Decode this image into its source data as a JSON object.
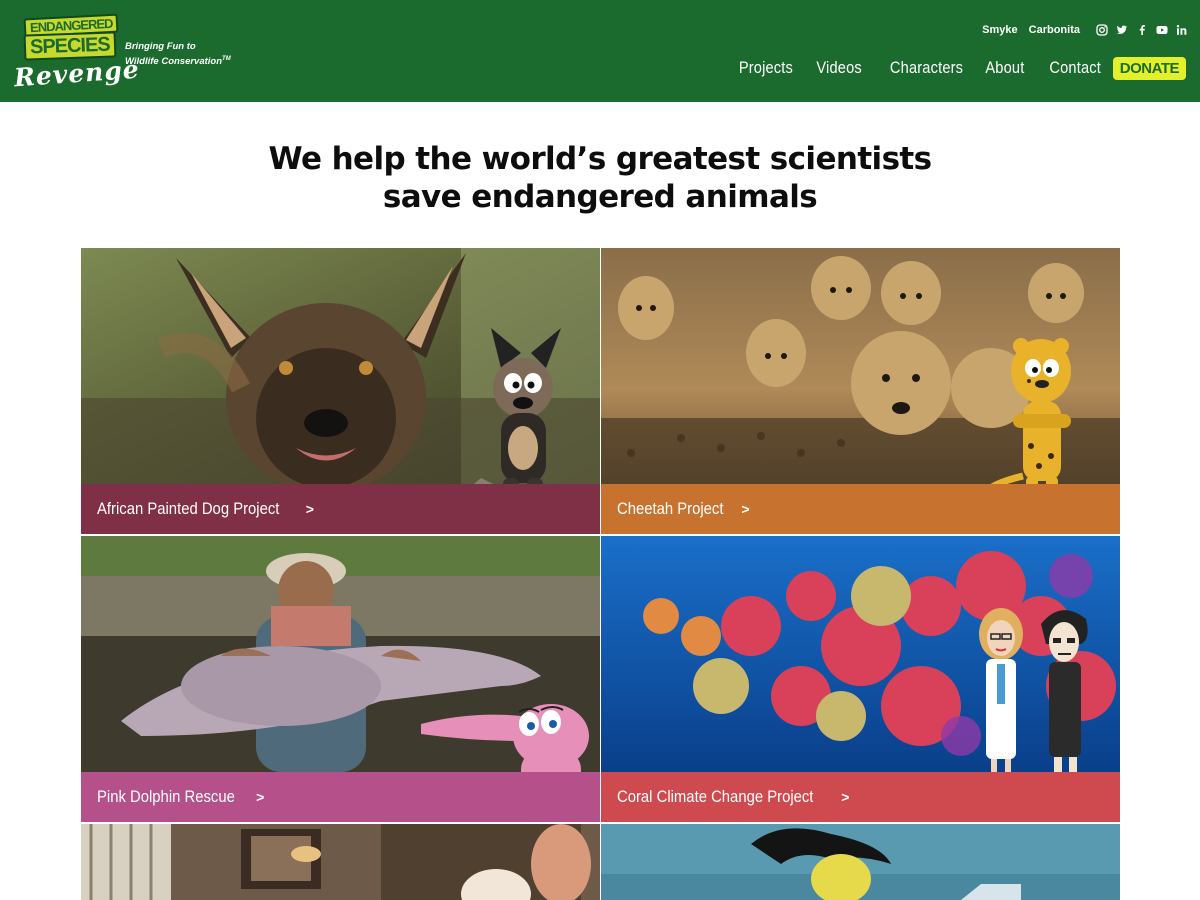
{
  "brand": {
    "logo_line1": "Endangered",
    "logo_line2": "Species",
    "logo_line3": "Revenge",
    "tagline_line1": "Bringing Fun to",
    "tagline_line2": "Wildlife Conservation",
    "tagline_mark": "TM",
    "colors": {
      "header_bg": "#1c6b2e",
      "accent": "#e4f12a"
    }
  },
  "top_links": [
    "Smyke",
    "Carbonita"
  ],
  "social_icons": [
    "instagram-icon",
    "twitter-icon",
    "facebook-icon",
    "youtube-icon",
    "linkedin-icon"
  ],
  "nav": {
    "items": [
      "Projects",
      "Videos",
      "Characters",
      "About",
      "Contact"
    ],
    "donate_label": "DONATE"
  },
  "headline": {
    "line1": "We help the world’s greatest scientists",
    "line2": "save endangered animals"
  },
  "projects": [
    {
      "label": "African Painted Dog Project",
      "bar_color": "#7f2f46"
    },
    {
      "label": "Cheetah Project",
      "bar_color": "#c7722f"
    },
    {
      "label": "Pink Dolphin Rescue",
      "bar_color": "#b6508a"
    },
    {
      "label": "Coral Climate Change Project",
      "bar_color": "#cf4a4f"
    }
  ],
  "chevron": ">"
}
